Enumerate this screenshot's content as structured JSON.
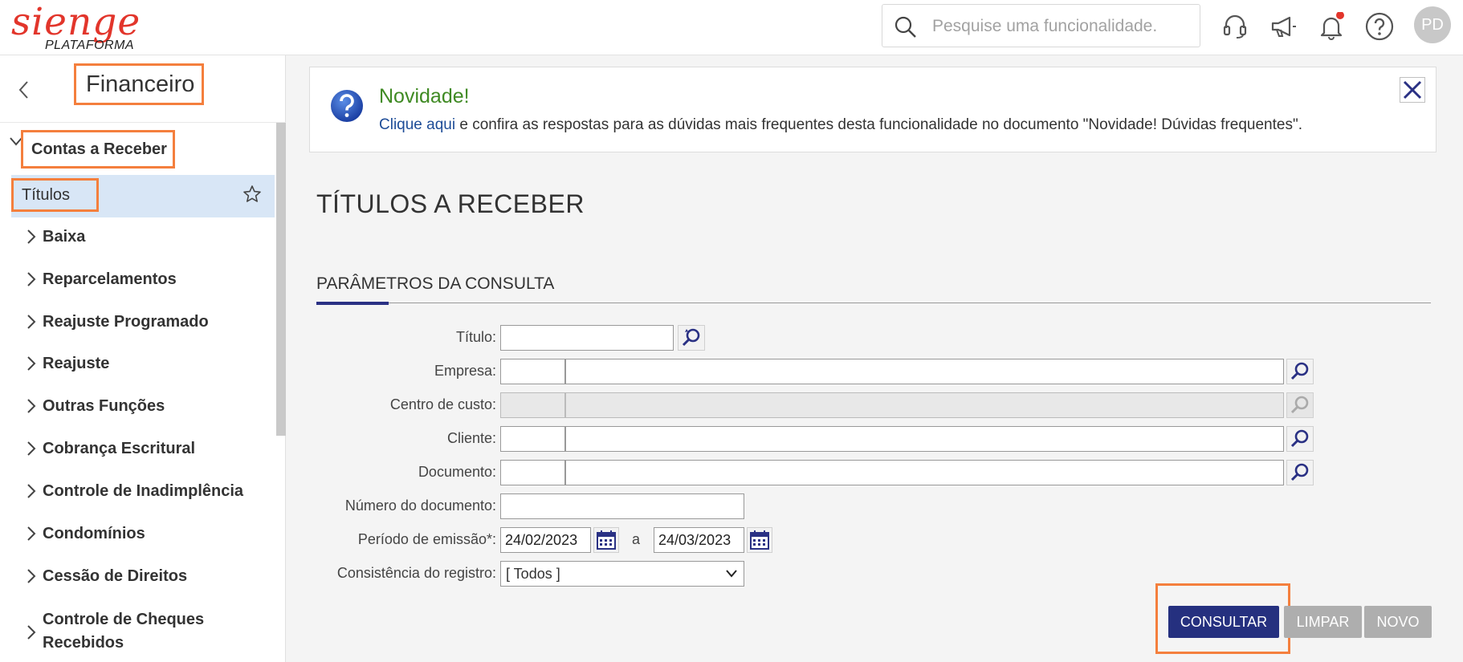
{
  "header": {
    "logo_text": "sienge",
    "logo_sub": "PLATAFORMA",
    "search_placeholder": "Pesquise uma funcionalidade.",
    "user_initials": "PD"
  },
  "sidebar": {
    "title": "Financeiro",
    "group": "Contas a Receber",
    "active_item": "Títulos",
    "items": [
      "Baixa",
      "Reparcelamentos",
      "Reajuste Programado",
      "Reajuste",
      "Outras Funções",
      "Cobrança Escritural",
      "Controle de Inadimplência",
      "Condomínios",
      "Cessão de Direitos",
      "Controle de Cheques Recebidos"
    ]
  },
  "notice": {
    "title": "Novidade!",
    "link": "Clique aqui",
    "text": " e confira as respostas para as dúvidas mais frequentes desta funcionalidade no documento \"Novidade! Dúvidas frequentes\"."
  },
  "page": {
    "title": "TÍTULOS A RECEBER",
    "section": "PARÂMETROS DA CONSULTA"
  },
  "form": {
    "titulo_label": "Título:",
    "empresa_label": "Empresa:",
    "centro_label": "Centro de custo:",
    "cliente_label": "Cliente:",
    "documento_label": "Documento:",
    "numero_label": "Número do documento:",
    "periodo_label": "Período de emissão*:",
    "date_from": "24/02/2023",
    "date_sep": "a",
    "date_to": "24/03/2023",
    "consistencia_label": "Consistência do registro:",
    "consistencia_value": "[ Todos ]"
  },
  "buttons": {
    "consultar": "CONSULTAR",
    "limpar": "LIMPAR",
    "novo": "NOVO"
  },
  "colors": {
    "accent": "#25307f",
    "highlight": "#f47f3d",
    "logo": "#e2352b",
    "notice_title": "#3f8a23"
  }
}
